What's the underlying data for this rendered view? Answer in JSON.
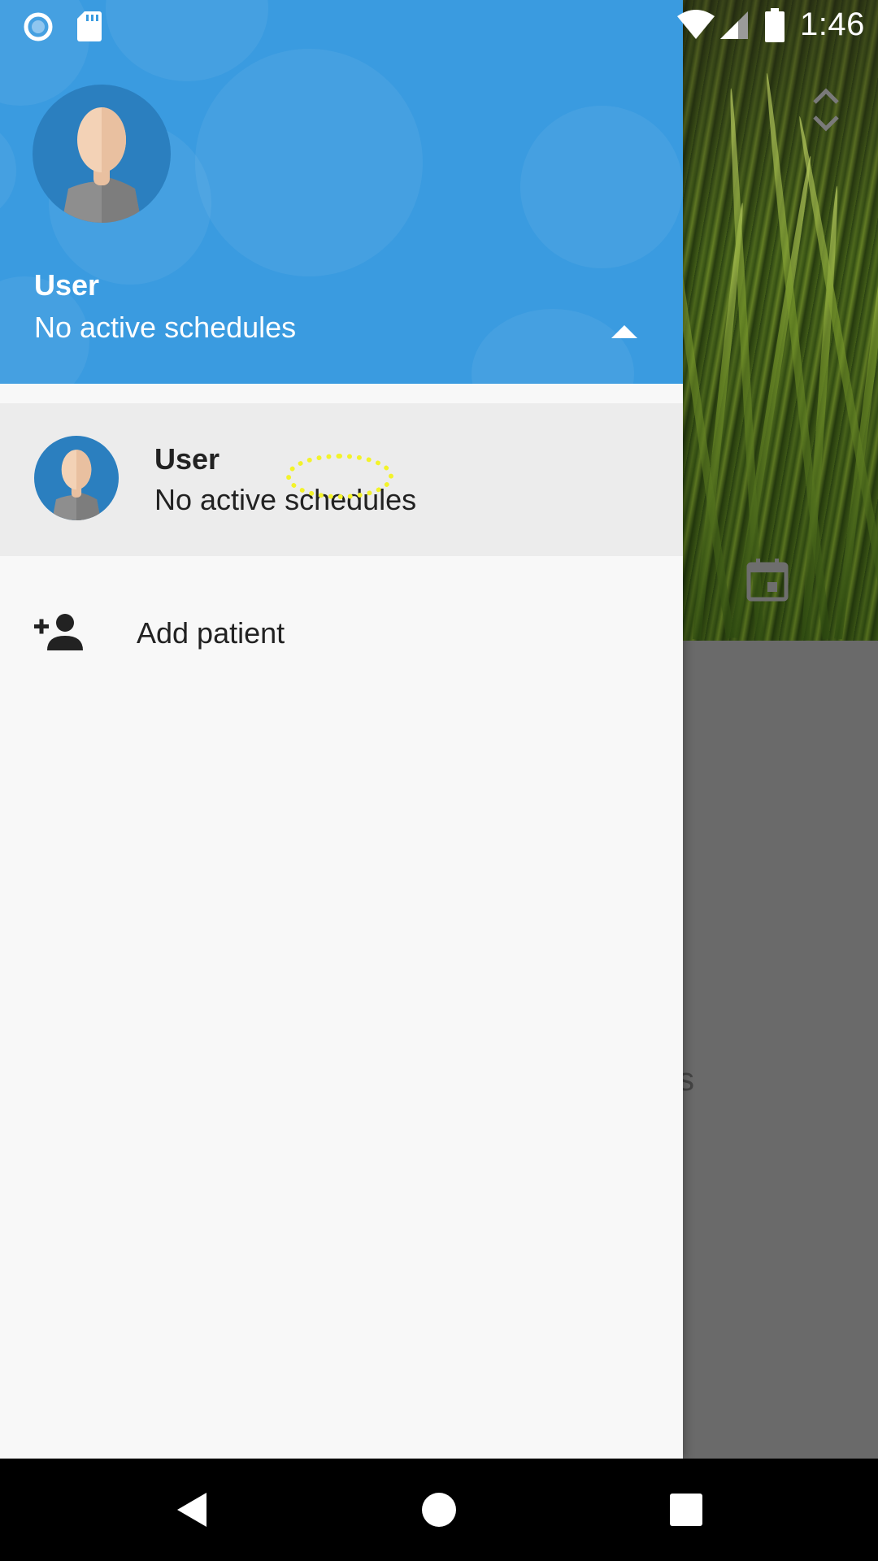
{
  "status_bar": {
    "time": "1:46",
    "icons": [
      "record-indicator-icon",
      "sd-card-icon",
      "wifi-icon",
      "signal-icon",
      "battery-icon"
    ]
  },
  "drawer": {
    "header": {
      "user_name": "User",
      "subtitle": "No active schedules",
      "toggle_icon": "triangle-up-icon",
      "background_color": "#3a9be0"
    },
    "accounts": [
      {
        "name": "User",
        "subtitle": "No active schedules"
      }
    ],
    "add_patient": {
      "label": "Add patient",
      "icon": "person-add-icon"
    }
  },
  "background_app": {
    "icons": [
      "reorder-icon",
      "calendar-icon"
    ],
    "partial_text": "s"
  },
  "nav_bar": {
    "buttons": [
      "back-icon",
      "home-icon",
      "recents-icon"
    ]
  },
  "colors": {
    "accent": "#3a9be0",
    "avatar_bg": "#2b7fbf",
    "selected_row": "#ececec",
    "touch_indicator": "#f3f32a"
  }
}
